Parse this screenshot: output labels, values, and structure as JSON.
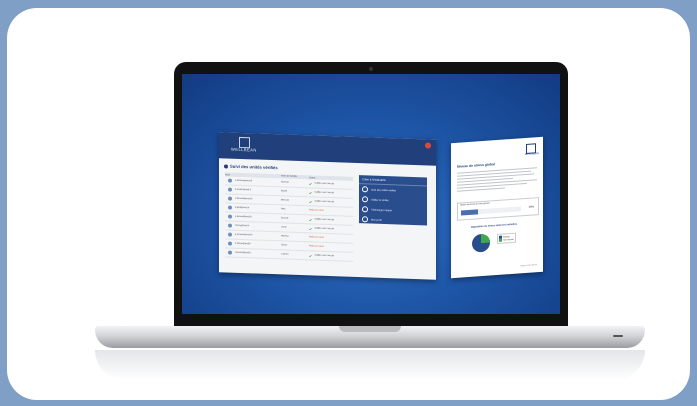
{
  "app": {
    "brand": "WELLBEAN",
    "title": "Suivi des unités vérifiés",
    "table": {
      "columns": [
        "Nom",
        "Nom de famille",
        "Statut"
      ],
      "rows": [
        {
          "name": "a.dumont@mail.fr",
          "family": "Dumont",
          "status": "Validée avec succès",
          "ok": true
        },
        {
          "name": "b.martin@mail.fr",
          "family": "Martin",
          "status": "Validée avec succès",
          "ok": true
        },
        {
          "name": "c.bernard@mail.fr",
          "family": "Bernard",
          "status": "Validée avec succès",
          "ok": true
        },
        {
          "name": "d.petit@mail.fr",
          "family": "Petit",
          "status": "Refus en cours",
          "ok": false
        },
        {
          "name": "e.durand@mail.fr",
          "family": "Durand",
          "status": "Validée avec succès",
          "ok": true
        },
        {
          "name": "f.leroy@mail.fr",
          "family": "Leroy",
          "status": "Validée avec succès",
          "ok": true
        },
        {
          "name": "g.moreau@mail.fr",
          "family": "Moreau",
          "status": "Refus en cours",
          "ok": false
        },
        {
          "name": "h.simon@mail.fr",
          "family": "Simon",
          "status": "Refus en cours",
          "ok": false
        },
        {
          "name": "i.laurent@mail.fr",
          "family": "Laurent",
          "status": "Validée avec succès",
          "ok": true
        }
      ]
    },
    "side_panel": {
      "title": "Créer à l'évaluation",
      "items": [
        "Suivi des unités vérifiés",
        "Valider et vérifier",
        "Télécharger rapport",
        "Mon profil"
      ]
    }
  },
  "report": {
    "brand": "WELLBEAN",
    "title": "Niveau de stress global",
    "progress_label": "Niveau de stress de votre groupe",
    "progress_value": "28%",
    "progress_fraction": 0.28,
    "pie_title": "Répartition du stress selon les individus",
    "legend": [
      "Stressé",
      "Non stressé"
    ],
    "pie_values": [
      75,
      25
    ],
    "colors": {
      "primary": "#2a4d8e",
      "secondary": "#3fa84a"
    },
    "footer": "Rapport WELLBEAN"
  }
}
